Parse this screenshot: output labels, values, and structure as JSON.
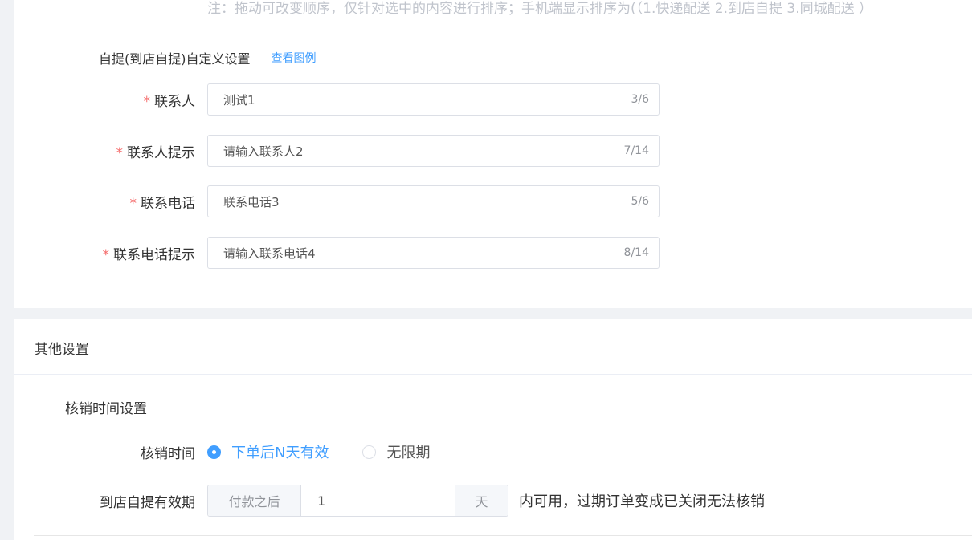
{
  "top": {
    "note": "注：拖动可改变顺序，仅针对选中的内容进行排序；手机端显示排序为(（1.快递配送 2.到店自提 3.同城配送 ）",
    "section_title": "自提(到店自提)自定义设置",
    "example_link": "查看图例",
    "required_mark": "*",
    "fields": [
      {
        "label": "联系人",
        "value": "测试1",
        "count": "3/6"
      },
      {
        "label": "联系人提示",
        "value": "请输入联系人2",
        "count": "7/14"
      },
      {
        "label": "联系电话",
        "value": "联系电话3",
        "count": "5/6"
      },
      {
        "label": "联系电话提示",
        "value": "请输入联系电话4",
        "count": "8/14"
      }
    ]
  },
  "other": {
    "title": "其他设置",
    "sub_title": "核销时间设置",
    "verify_time": {
      "label": "核销时间",
      "options": [
        "下单后N天有效",
        "无限期"
      ],
      "selected": "下单后N天有效"
    },
    "validity": {
      "label": "到店自提有效期",
      "prepend": "付款之后",
      "value": "1",
      "append": "天",
      "after": "内可用，过期订单变成已关闭无法核销"
    }
  },
  "colors": {
    "accent": "#409eff",
    "required": "#f56c6c",
    "background": "#f0f2f5"
  }
}
